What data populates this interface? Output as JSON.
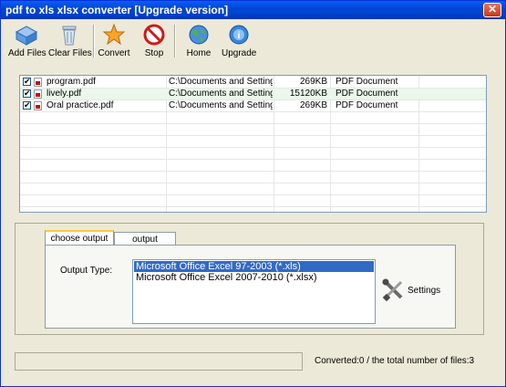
{
  "window": {
    "title": "pdf to xls xlsx converter [Upgrade version]",
    "close_glyph": "✕"
  },
  "toolbar": {
    "items": [
      {
        "label": "Add Files",
        "icon": "add-files-icon"
      },
      {
        "label": "Clear Files",
        "icon": "trash-icon"
      },
      {
        "label": "Convert",
        "icon": "star-icon"
      },
      {
        "label": "Stop",
        "icon": "stop-icon"
      },
      {
        "label": "Home",
        "icon": "globe-icon"
      },
      {
        "label": "Upgrade",
        "icon": "upgrade-icon"
      }
    ]
  },
  "files": [
    {
      "checked": true,
      "name": "program.pdf",
      "path": "C:\\Documents and Setting...",
      "size": "269KB",
      "type": "PDF Document"
    },
    {
      "checked": true,
      "name": "lively.pdf",
      "path": "C:\\Documents and Setting...",
      "size": "15120KB",
      "type": "PDF Document"
    },
    {
      "checked": true,
      "name": "Oral practice.pdf",
      "path": "C:\\Documents and Setting...",
      "size": "269KB",
      "type": "PDF Document"
    }
  ],
  "check_glyph": "✔",
  "tabs": {
    "output_file": "choose output file",
    "output_directory": "output directory"
  },
  "output": {
    "label": "Output Type:",
    "options": [
      {
        "label": "Microsoft Office Excel 97-2003 (*.xls)",
        "selected": true
      },
      {
        "label": "Microsoft Office Excel 2007-2010 (*.xlsx)",
        "selected": false
      }
    ],
    "settings_label": "Settings"
  },
  "status": {
    "text": "Converted:0  /  the total number of files:3",
    "progress": 0
  },
  "colors": {
    "titlebar": "#0047d6",
    "selection": "#316ac5",
    "alt_row": "#eaf7ea"
  }
}
